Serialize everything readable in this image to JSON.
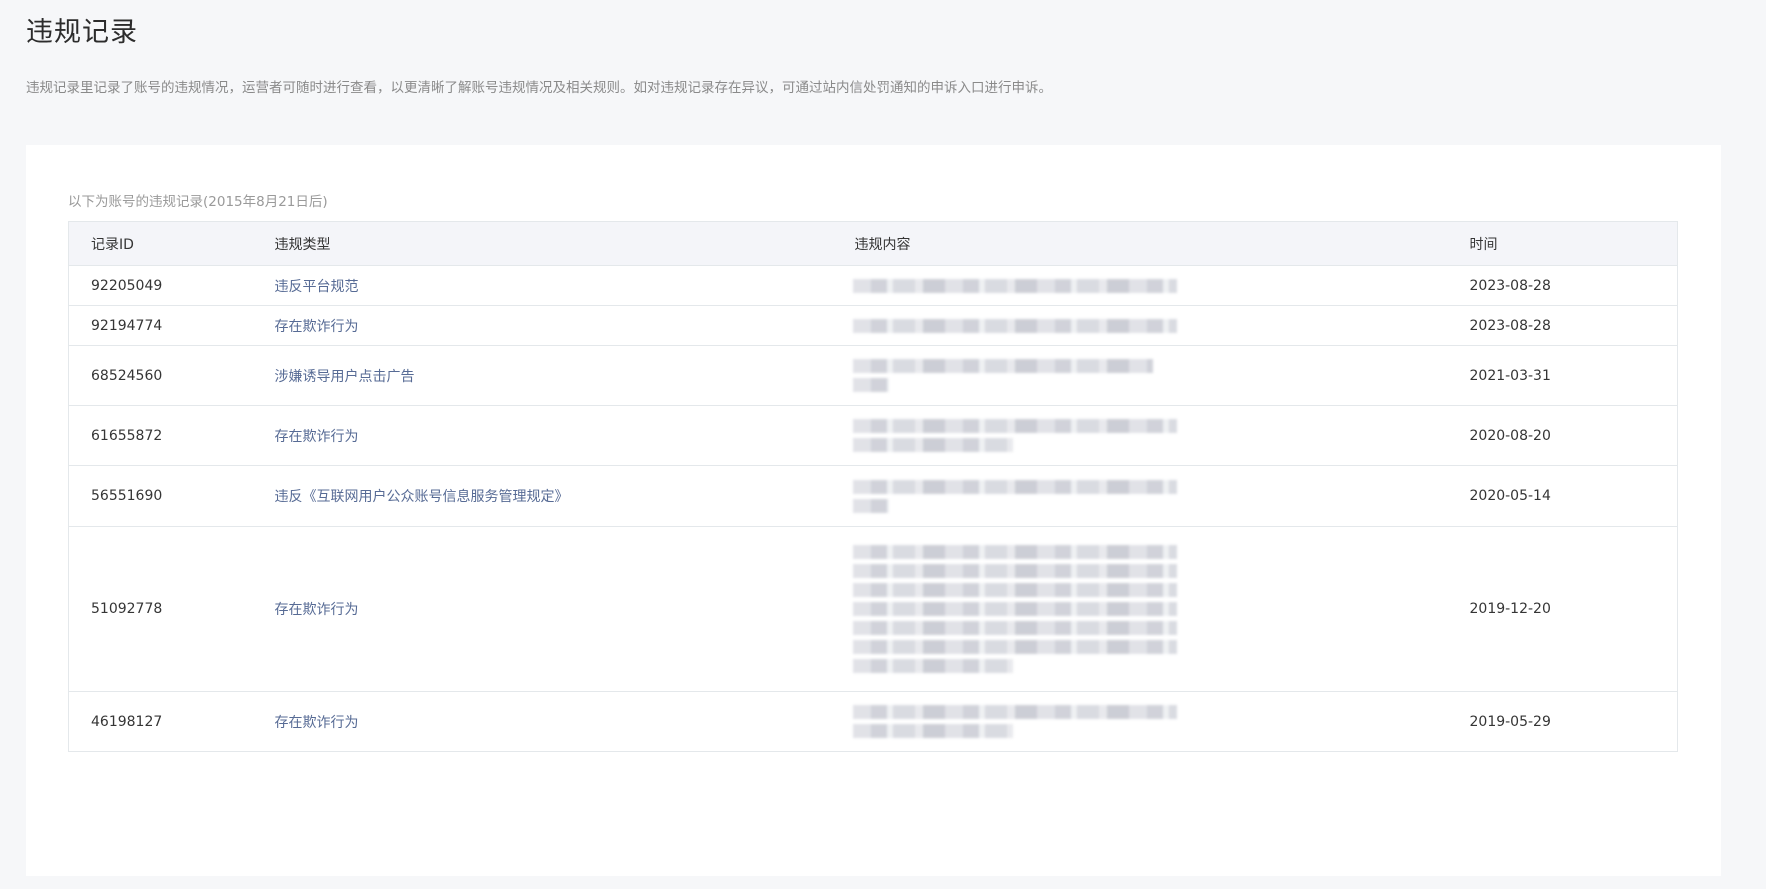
{
  "page": {
    "title": "违规记录",
    "description": "违规记录里记录了账号的违规情况，运营者可随时进行查看，以更清晰了解账号违规情况及相关规则。如对违规记录存在异议，可通过站内信处罚通知的申诉入口进行申诉。"
  },
  "card": {
    "caption": "以下为账号的违规记录(2015年8月21日后)"
  },
  "table": {
    "headers": {
      "id": "记录ID",
      "type": "违规类型",
      "content": "违规内容",
      "time": "时间"
    },
    "rows": [
      {
        "id": "92205049",
        "type": "违反平台规范",
        "time": "2023-08-28"
      },
      {
        "id": "92194774",
        "type": "存在欺诈行为",
        "time": "2023-08-28"
      },
      {
        "id": "68524560",
        "type": "涉嫌诱导用户点击广告",
        "time": "2021-03-31"
      },
      {
        "id": "61655872",
        "type": "存在欺诈行为",
        "time": "2020-08-20"
      },
      {
        "id": "56551690",
        "type": "违反《互联网用户公众账号信息服务管理规定》",
        "time": "2020-05-14"
      },
      {
        "id": "51092778",
        "type": "存在欺诈行为",
        "time": "2019-12-20"
      },
      {
        "id": "46198127",
        "type": "存在欺诈行为",
        "time": "2019-05-29"
      }
    ]
  },
  "colors": {
    "link": "#576b95",
    "page_background": "#f6f7f9",
    "header_background": "#f4f5f9",
    "border": "#e4e8eb"
  }
}
